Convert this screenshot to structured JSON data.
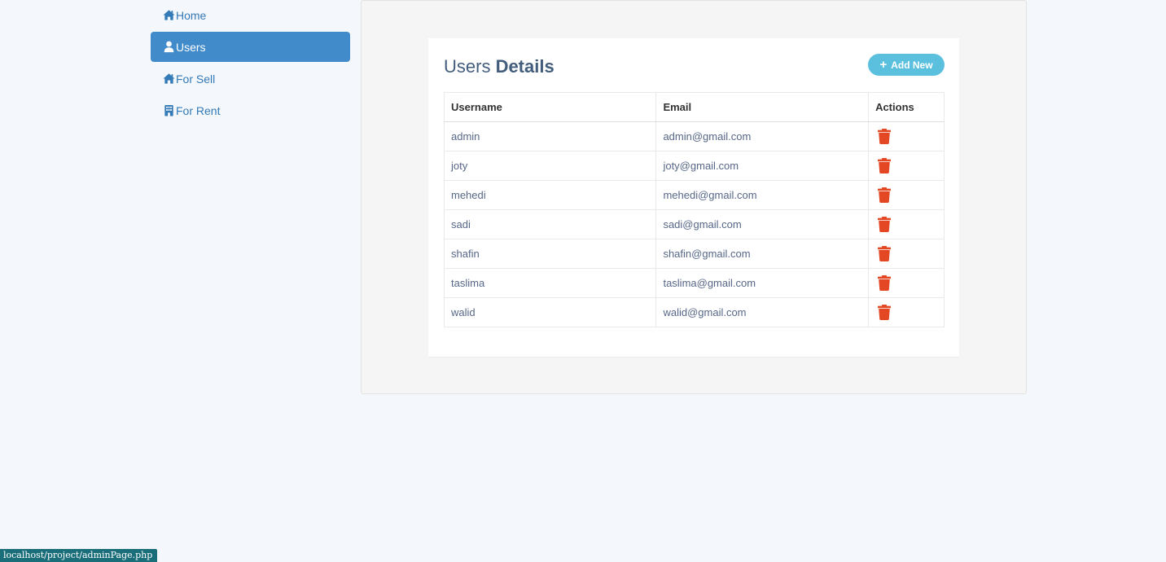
{
  "sidebar": {
    "items": [
      {
        "label": "Home",
        "icon": "home-icon",
        "active": false
      },
      {
        "label": "Users",
        "icon": "user-icon",
        "active": true
      },
      {
        "label": "For Sell",
        "icon": "home-icon",
        "active": false
      },
      {
        "label": "For Rent",
        "icon": "building-icon",
        "active": false
      }
    ]
  },
  "card": {
    "title_plain": "Users ",
    "title_bold": "Details",
    "add_button_label": "Add New",
    "add_button_icon": "plus-icon"
  },
  "table": {
    "columns": [
      "Username",
      "Email",
      "Actions"
    ],
    "rows": [
      {
        "username": "admin",
        "email": "admin@gmail.com"
      },
      {
        "username": "joty",
        "email": "joty@gmail.com"
      },
      {
        "username": "mehedi",
        "email": "mehedi@gmail.com"
      },
      {
        "username": "sadi",
        "email": "sadi@gmail.com"
      },
      {
        "username": "shafin",
        "email": "shafin@gmail.com"
      },
      {
        "username": "taslima",
        "email": "taslima@gmail.com"
      },
      {
        "username": "walid",
        "email": "walid@gmail.com"
      }
    ],
    "action_icon": "trash-icon"
  },
  "status_bar": {
    "url": "localhost/project/adminPage.php"
  },
  "colors": {
    "accent": "#428bca",
    "link": "#337ab7",
    "add_button": "#5bc0de",
    "delete": "#e34724",
    "title": "#435d7d"
  }
}
